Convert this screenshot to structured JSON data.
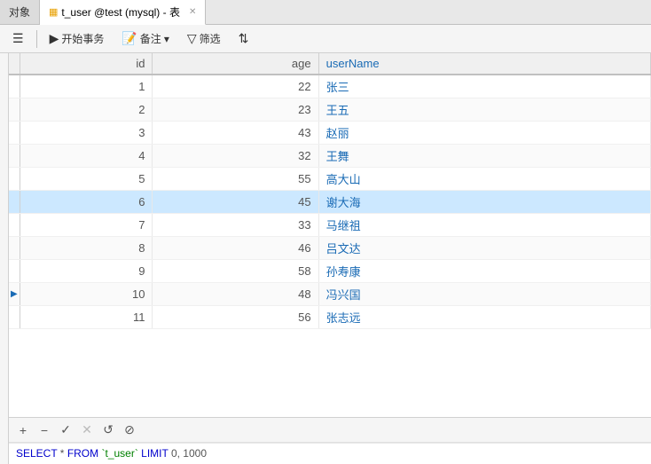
{
  "tabs": [
    {
      "id": "objects",
      "label": "对象",
      "active": false,
      "icon": null
    },
    {
      "id": "table",
      "label": "t_user @test (mysql) - 表",
      "active": true,
      "icon": "table"
    }
  ],
  "toolbar": {
    "menu_label": "",
    "start_transaction": "开始事务",
    "notes": "备注",
    "filter": "筛选"
  },
  "table": {
    "columns": [
      {
        "key": "id",
        "label": "id"
      },
      {
        "key": "age",
        "label": "age"
      },
      {
        "key": "userName",
        "label": "userName"
      }
    ],
    "rows": [
      {
        "id": 1,
        "age": 22,
        "userName": "张三",
        "selected": false
      },
      {
        "id": 2,
        "age": 23,
        "userName": "王五",
        "selected": false
      },
      {
        "id": 3,
        "age": 43,
        "userName": "赵丽",
        "selected": false
      },
      {
        "id": 4,
        "age": 32,
        "userName": "王舞",
        "selected": false
      },
      {
        "id": 5,
        "age": 55,
        "userName": "高大山",
        "selected": false
      },
      {
        "id": 6,
        "age": 45,
        "userName": "谢大海",
        "selected": true
      },
      {
        "id": 7,
        "age": 33,
        "userName": "马继祖",
        "selected": false
      },
      {
        "id": 8,
        "age": 46,
        "userName": "吕文达",
        "selected": false
      },
      {
        "id": 9,
        "age": 58,
        "userName": "孙寿康",
        "selected": false
      },
      {
        "id": 10,
        "age": 48,
        "userName": "冯兴国",
        "selected": false,
        "current": true
      },
      {
        "id": 11,
        "age": 56,
        "userName": "张志远",
        "selected": false
      }
    ]
  },
  "bottom_toolbar": {
    "buttons": [
      "+",
      "−",
      "✓",
      "✕",
      "↺",
      "⊘"
    ]
  },
  "sql": "SELECT * FROM `t_user` LIMIT 0, 1000"
}
